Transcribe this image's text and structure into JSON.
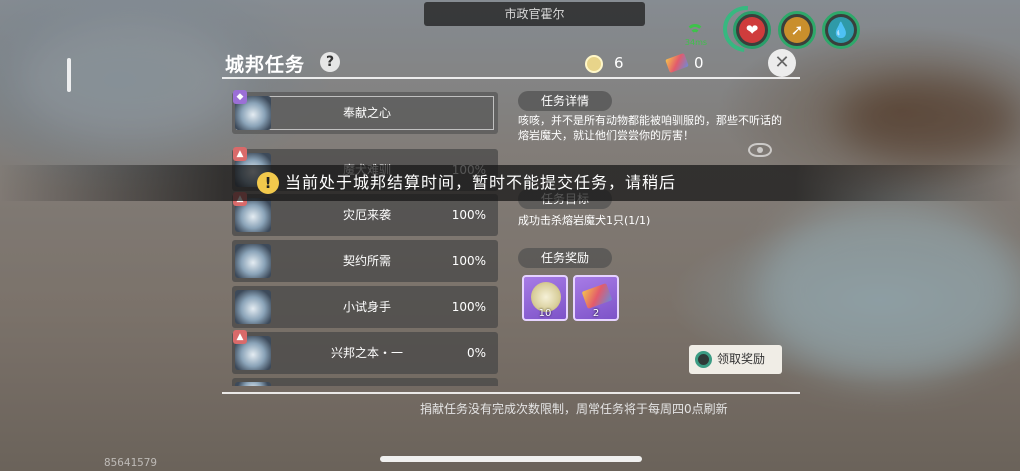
{
  "npc_name": "市政官霍尔",
  "status": {
    "ping": "34ms",
    "icons": [
      "heart-icon",
      "stamina-icon",
      "water-drop-icon"
    ]
  },
  "panel": {
    "title": "城邦任务",
    "help_icon": "?",
    "currencies": [
      {
        "icon": "city-coin-icon",
        "value": "6"
      },
      {
        "icon": "ticket-icon",
        "value": "0"
      }
    ],
    "close_icon": "✕"
  },
  "quests": [
    {
      "name": "奉献之心",
      "percent": "",
      "badge": "purple",
      "active": true
    },
    {
      "name": "魔犬难驯",
      "percent": "100%",
      "badge": "red",
      "active": false
    },
    {
      "name": "灾厄来袭",
      "percent": "100%",
      "badge": "red",
      "active": false
    },
    {
      "name": "契约所需",
      "percent": "100%",
      "badge": "",
      "active": false
    },
    {
      "name": "小试身手",
      "percent": "100%",
      "badge": "",
      "active": false
    },
    {
      "name": "兴邦之本・一",
      "percent": "0%",
      "badge": "red",
      "active": false
    }
  ],
  "detail": {
    "details_heading": "任务详情",
    "description": "咳咳，并不是所有动物都能被咱驯服的，那些不听话的熔岩魔犬，就让他们尝尝你的厉害！",
    "objective_heading": "任务目标",
    "objective": "成功击杀熔岩魔犬1只(1/1)",
    "rewards_heading": "任务奖励",
    "rewards": [
      {
        "icon": "city-coin-icon",
        "qty": "10"
      },
      {
        "icon": "ticket-icon",
        "qty": "2"
      }
    ],
    "claim_label": "领取奖励"
  },
  "footer_note": "捐献任务没有完成次数限制，周常任务将于每周四0点刷新",
  "uid": "85641579",
  "toast": {
    "icon": "!",
    "message": "当前处于城邦结算时间，暂时不能提交任务，请稍后"
  },
  "colors": {
    "accent_green": "#3ec24b",
    "panel_bg": "#464646",
    "reward_purple": "#8f63d6"
  }
}
